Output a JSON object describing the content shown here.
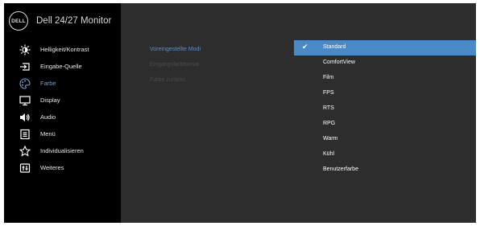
{
  "header": {
    "logo_text": "DELL",
    "title": "Dell 24/27 Monitor"
  },
  "menu": [
    {
      "label": "Helligkeit/Kontrast",
      "icon": "brightness-icon"
    },
    {
      "label": "Eingabe-Quelle",
      "icon": "input-source-icon"
    },
    {
      "label": "Farbe",
      "icon": "color-palette-icon",
      "active": true
    },
    {
      "label": "Display",
      "icon": "display-icon"
    },
    {
      "label": "Audio",
      "icon": "audio-icon"
    },
    {
      "label": "Menü",
      "icon": "menu-icon"
    },
    {
      "label": "Individualisieren",
      "icon": "star-icon"
    },
    {
      "label": "Weiteres",
      "icon": "others-icon"
    }
  ],
  "submenu": [
    {
      "label": "Voreingestellte Modi",
      "state": "active"
    },
    {
      "label": "Eingangsfarbformat",
      "state": "disabled"
    },
    {
      "label": "Farbe zurücks",
      "state": "disabled"
    }
  ],
  "options": {
    "selected": "Standard",
    "items": [
      "Standard",
      "ComfortView",
      "Film",
      "FPS",
      "RTS",
      "RPG",
      "Warm",
      "Kühl",
      "Benutzerfarbe"
    ]
  },
  "colors": {
    "accent": "#4a89c8",
    "active_text": "#6fa1d6",
    "panel": "#2d2d2d",
    "nav": "#000000"
  }
}
